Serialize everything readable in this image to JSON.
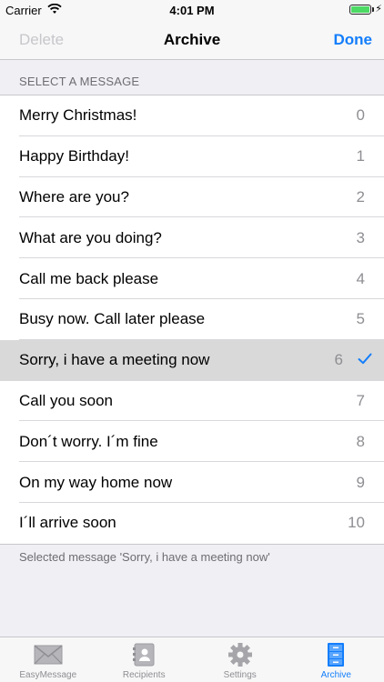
{
  "status_bar": {
    "carrier": "Carrier",
    "time": "4:01 PM"
  },
  "nav": {
    "left_label": "Delete",
    "title": "Archive",
    "right_label": "Done"
  },
  "section_header": "SELECT A MESSAGE",
  "messages": [
    {
      "label": "Merry Christmas!",
      "num": "0"
    },
    {
      "label": "Happy Birthday!",
      "num": "1"
    },
    {
      "label": "Where are you?",
      "num": "2"
    },
    {
      "label": "What are you doing?",
      "num": "3"
    },
    {
      "label": "Call me back please",
      "num": "4"
    },
    {
      "label": "Busy now. Call later please",
      "num": "5"
    },
    {
      "label": "Sorry, i have a meeting now",
      "num": "6"
    },
    {
      "label": "Call you soon",
      "num": "7"
    },
    {
      "label": "Don´t worry. I´m fine",
      "num": "8"
    },
    {
      "label": "On my way home now",
      "num": "9"
    },
    {
      "label": "I´ll arrive soon",
      "num": "10"
    }
  ],
  "selected_index": 6,
  "footer_note": "Selected message 'Sorry, i have a meeting now'",
  "tabs": [
    {
      "label": "EasyMessage",
      "icon": "envelope-icon"
    },
    {
      "label": "Recipients",
      "icon": "contacts-book-icon"
    },
    {
      "label": "Settings",
      "icon": "gear-icon"
    },
    {
      "label": "Archive",
      "icon": "file-cabinet-icon"
    }
  ],
  "active_tab": 3,
  "colors": {
    "accent": "#147efb",
    "battery": "#4cd964",
    "selected_row": "#d9d9d9"
  }
}
